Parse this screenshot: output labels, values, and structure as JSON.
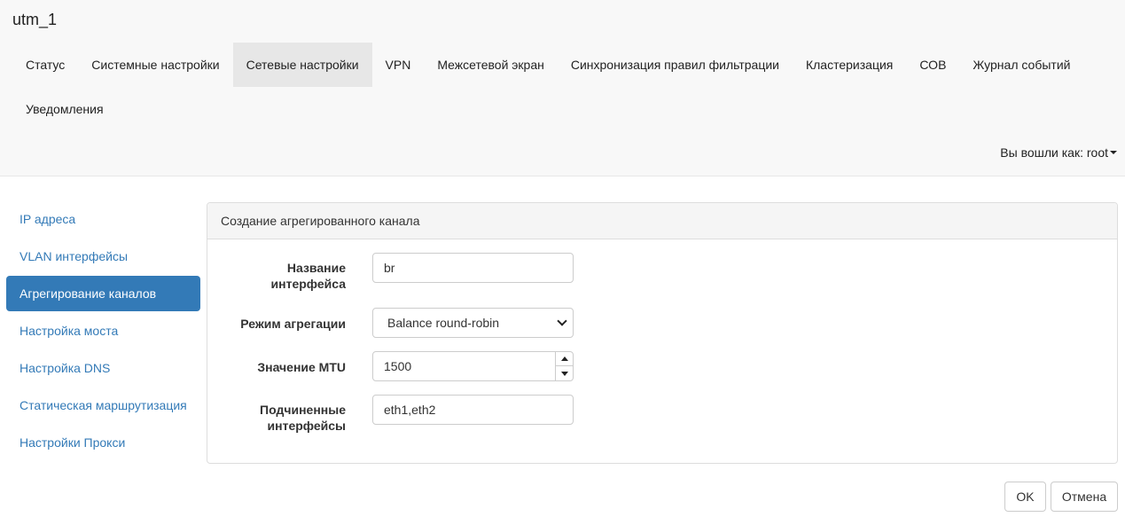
{
  "app": {
    "title": "utm_1"
  },
  "nav": {
    "items": [
      "Статус",
      "Системные настройки",
      "Сетевые настройки",
      "VPN",
      "Межсетевой экран",
      "Синхронизация правил фильтрации",
      "Кластеризация",
      "СОВ",
      "Журнал событий",
      "Уведомления"
    ],
    "active": "Сетевые настройки"
  },
  "user": {
    "label": "Вы вошли как: root"
  },
  "sidebar": {
    "items": [
      "IP адреса",
      "VLAN интерфейсы",
      "Агрегирование каналов",
      "Настройка моста",
      "Настройка DNS",
      "Статическая маршрутизация",
      "Настройки Прокси"
    ],
    "active": "Агрегирование каналов"
  },
  "panel": {
    "title": "Создание агрегированного канала",
    "fields": {
      "name": {
        "label_line1": "Название",
        "label_line2": "интерфейса",
        "value": "br"
      },
      "mode": {
        "label": "Режим агрегации",
        "value": "Balance round-robin"
      },
      "mtu": {
        "label": "Значение MTU",
        "value": "1500"
      },
      "slaves": {
        "label_line1": "Подчиненные",
        "label_line2": "интерфейсы",
        "value": "eth1,eth2"
      }
    }
  },
  "buttons": {
    "ok": "OK",
    "cancel": "Отмена"
  },
  "colors": {
    "accent": "#337ab7",
    "navbar_bg": "#f8f8f8",
    "nav_active_bg": "#e7e7e7"
  },
  "icons": {
    "user_menu": "caret-down-icon",
    "select": "chevron-down-icon",
    "spin_up": "triangle-up-icon",
    "spin_down": "triangle-down-icon"
  }
}
